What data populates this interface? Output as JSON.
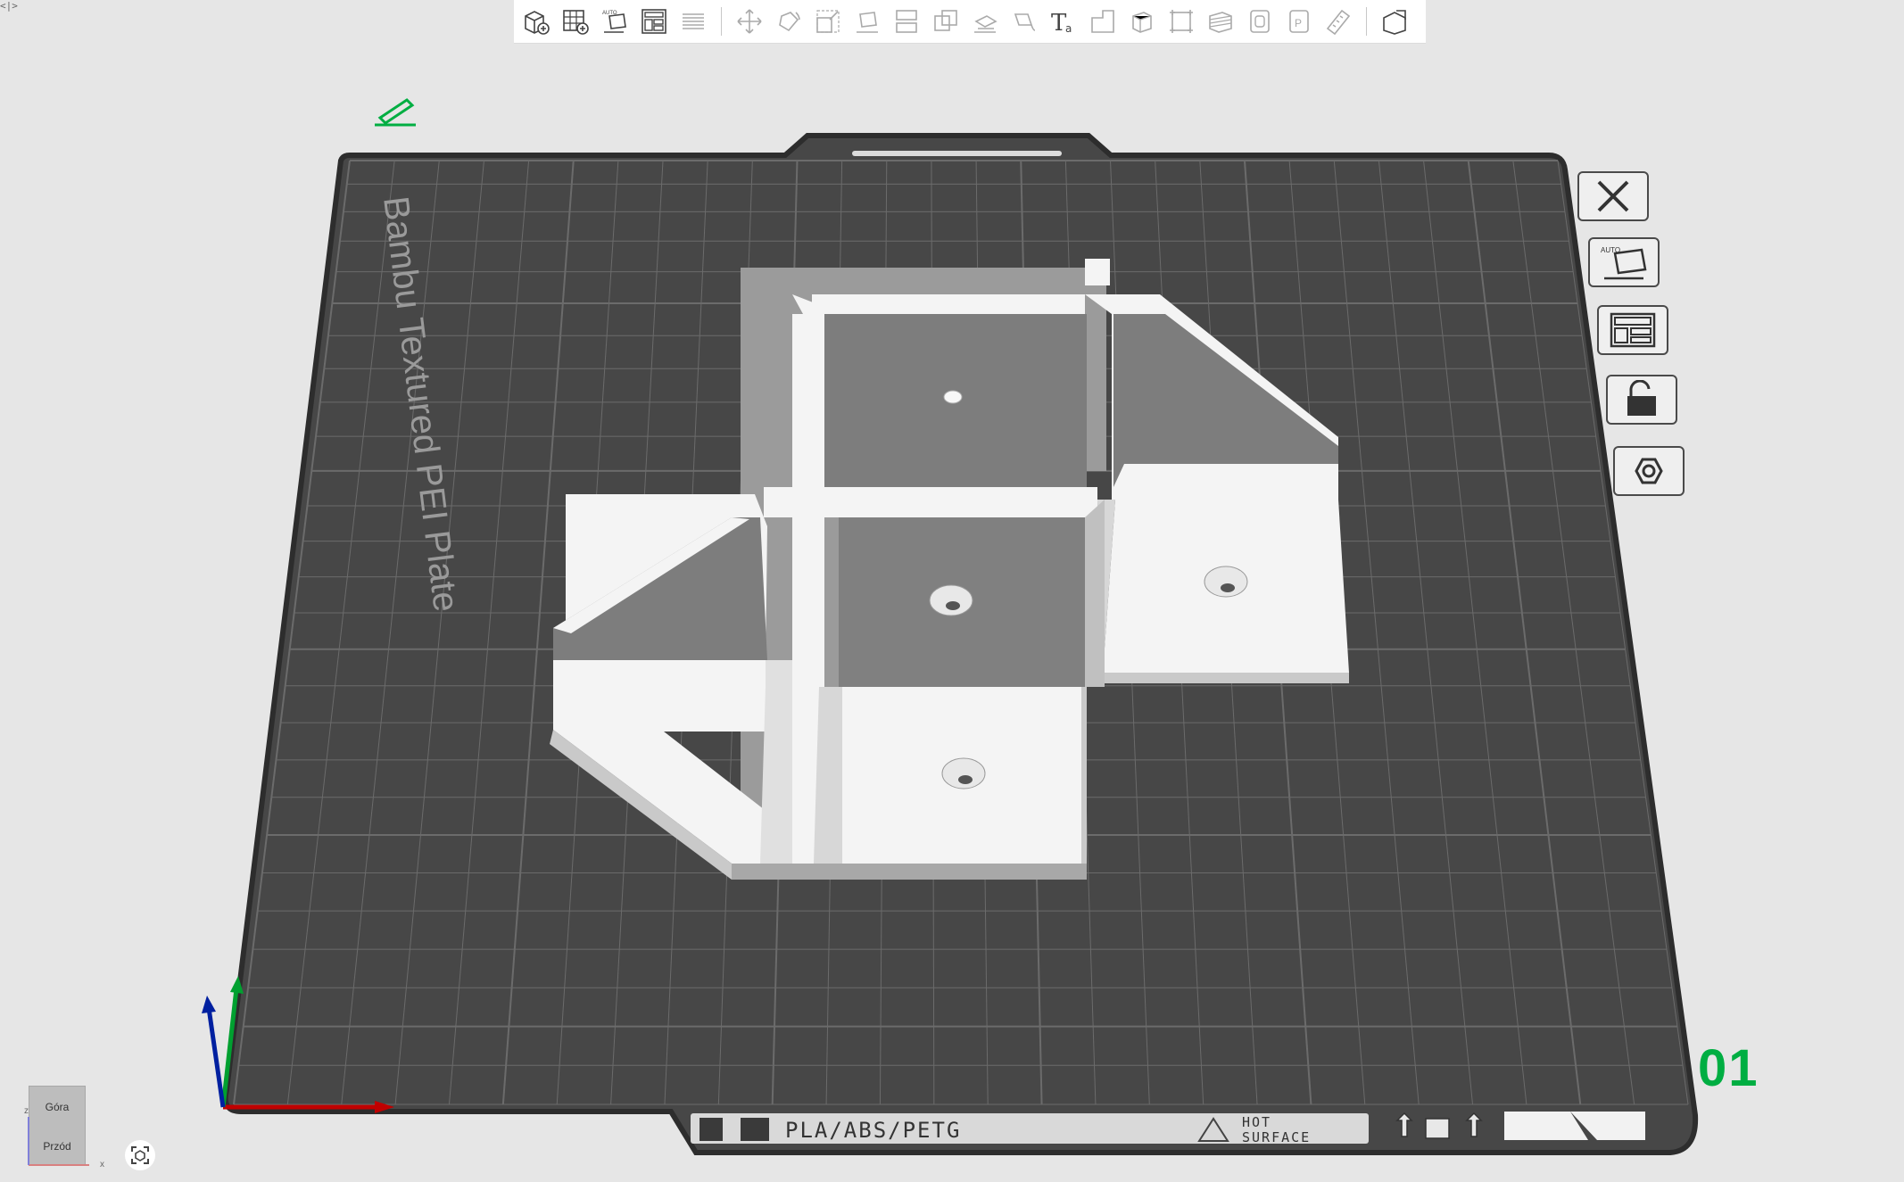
{
  "app": {
    "corner_toggle": "<|>"
  },
  "toolbar": {
    "groups": [
      [
        "add-object-icon",
        "add-plate-icon",
        "auto-orient-icon",
        "arrange-icon",
        "layers-icon"
      ],
      [
        "move-icon",
        "rotate-icon",
        "scale-icon",
        "lay-on-face-icon",
        "cut-icon",
        "boolean-icon",
        "support-paint-icon",
        "seam-paint-icon",
        "text-icon",
        "measure-icon",
        "assembly-icon",
        "variable-layer-icon",
        "emboss-icon",
        "brim-ears-icon",
        "mesh-boolean-icon",
        "ruler-icon"
      ],
      [
        "assembly-view-icon"
      ]
    ]
  },
  "plate": {
    "name": "Bambu Textured PEI Plate",
    "filaments": "PLA/ABS/PETG",
    "warning": "HOT\nSURFACE",
    "number": "01"
  },
  "view_cube": {
    "top": "Góra",
    "front": "Przód"
  },
  "axes": {
    "x": "x",
    "z": "z"
  },
  "colors": {
    "plate": "#474747",
    "plate_border": "#2d2d2d",
    "grid": "#6b6b6b",
    "model_light": "#f4f4f4",
    "model_mid": "#c9c9c9",
    "model_dark": "#7a7a7a",
    "accent_green": "#00ae42"
  }
}
